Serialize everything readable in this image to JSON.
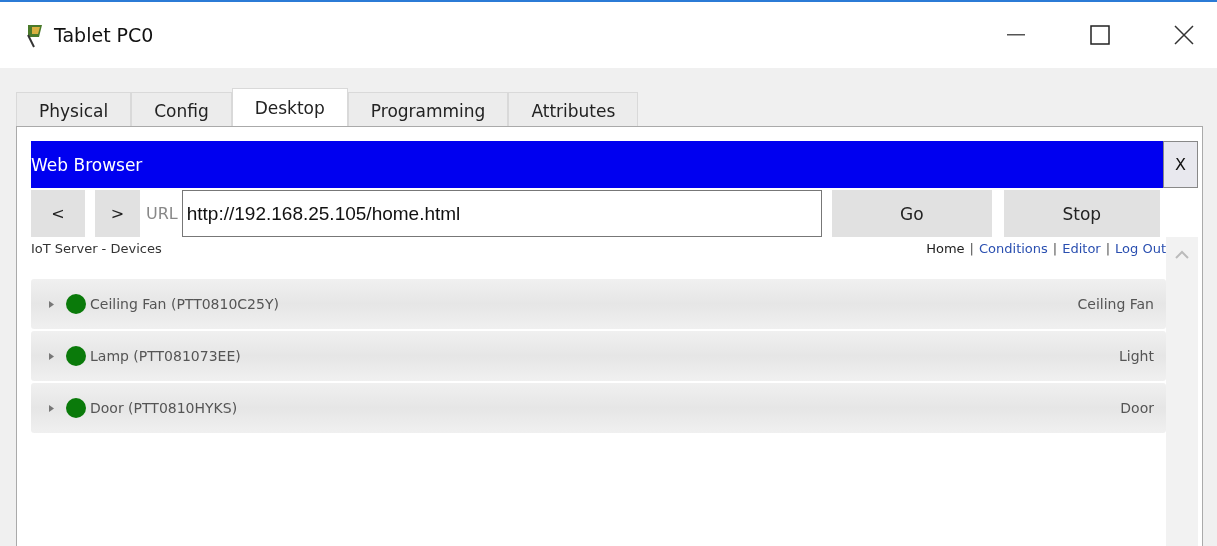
{
  "window": {
    "title": "Tablet PC0"
  },
  "tabs": [
    {
      "label": "Physical",
      "selected": false
    },
    {
      "label": "Config",
      "selected": false
    },
    {
      "label": "Desktop",
      "selected": true
    },
    {
      "label": "Programming",
      "selected": false
    },
    {
      "label": "Attributes",
      "selected": false
    }
  ],
  "browser": {
    "title": "Web Browser",
    "close": "X",
    "back": "<",
    "forward": ">",
    "url_label": "URL",
    "url": "http://192.168.25.105/home.html",
    "go": "Go",
    "stop": "Stop"
  },
  "page": {
    "heading": "IoT Server - Devices",
    "nav_separator": "|",
    "nav": [
      {
        "label": "Home",
        "selected": true
      },
      {
        "label": "Conditions",
        "selected": false
      },
      {
        "label": "Editor",
        "selected": false
      },
      {
        "label": "Log Out",
        "selected": false
      }
    ],
    "devices": [
      {
        "name": "Ceiling Fan (PTT0810C25Y)",
        "type": "Ceiling Fan",
        "color": "#0a7a0a"
      },
      {
        "name": "Lamp (PTT081073EE)",
        "type": "Light",
        "color": "#0a7a0a"
      },
      {
        "name": "Door (PTT0810HYKS)",
        "type": "Door",
        "color": "#0a7a0a"
      }
    ]
  }
}
